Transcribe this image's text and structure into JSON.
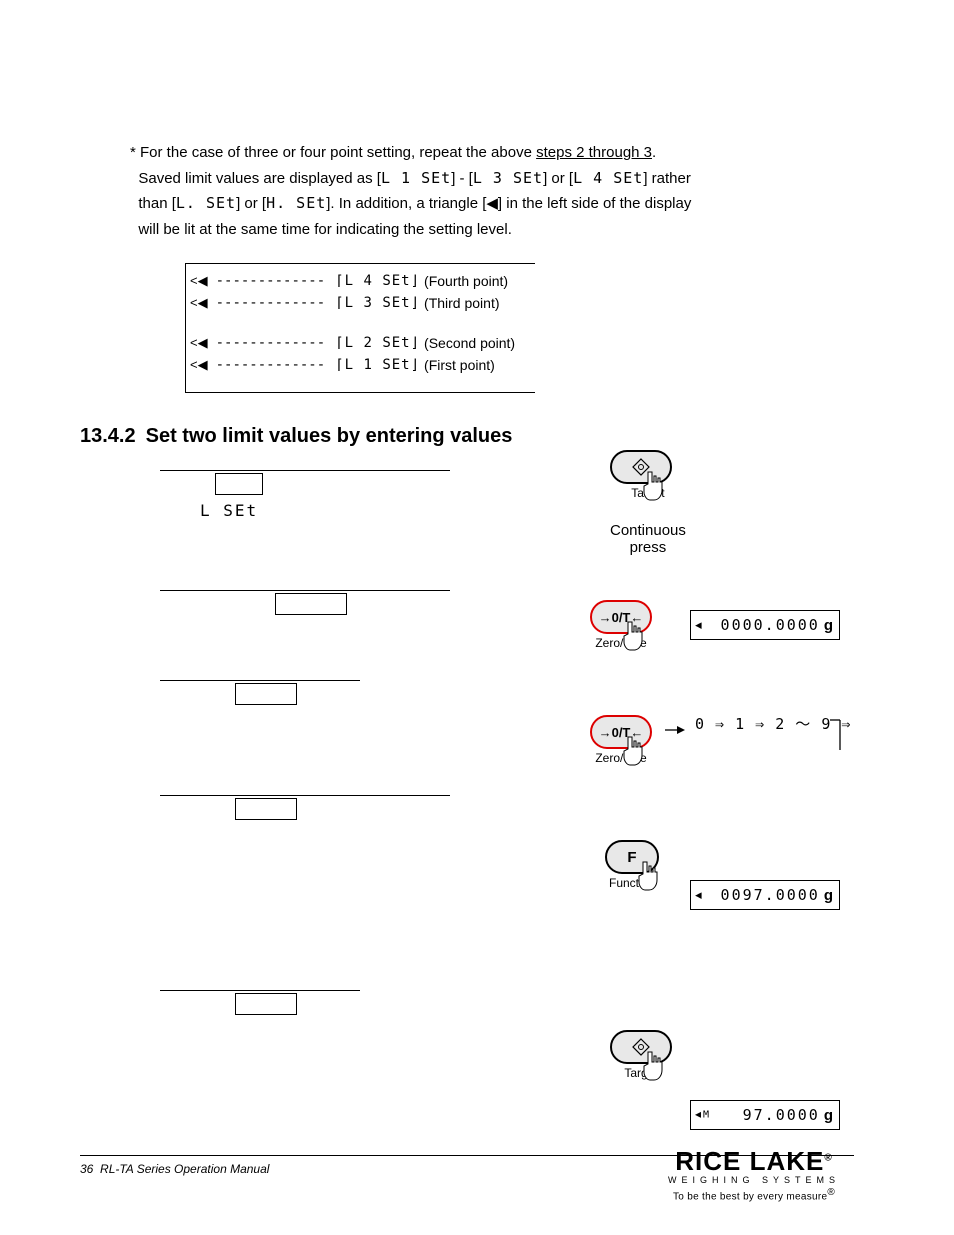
{
  "intro": {
    "asterisk": "*",
    "line1a": "For the case of three or four point setting, repeat the above ",
    "line1b": "steps 2 through 3",
    "line1c": ".",
    "line2a": "Saved limit values are displayed as [",
    "seg_l1": "L 1  SEt",
    "line2b": "] - [",
    "seg_l3": "L 3  SEt",
    "line2c": "] or [",
    "seg_l4": "L 4  SEt",
    "line2d": "] rather",
    "line3a": "than [",
    "seg_l": "L.  SEt",
    "line3b": "] or [",
    "seg_h": "H.  SEt",
    "line3c": "].   In addition, a triangle [◀] in the left side of the display",
    "line4": "will be lit at the same time for indicating the setting level."
  },
  "diagram": {
    "rows": [
      {
        "marker": "<◀",
        "dashes": "-------------",
        "seg": "⌈L 4  SEt⌋",
        "label": "(Fourth point)"
      },
      {
        "marker": "<◀",
        "dashes": "-------------",
        "seg": "⌈L 3  SEt⌋",
        "label": "(Third point)"
      },
      {
        "marker": "<◀",
        "dashes": "-------------",
        "seg": "⌈L 2  SEt⌋",
        "label": "(Second point)"
      },
      {
        "marker": "<◀",
        "dashes": "-------------",
        "seg": "⌈L 1  SEt⌋",
        "label": "(First point)"
      }
    ]
  },
  "heading": {
    "number": "13.4.2",
    "title": "Set two limit values by entering values"
  },
  "steps": {
    "lset": "L  SEt"
  },
  "illus": {
    "target_label": "Target",
    "continuous": "Continuous",
    "press": "press",
    "zero_key": "→0/T←",
    "zero_label": "Zero/Tare",
    "f_key": "F",
    "func_label": "Function",
    "lcd1": "0000.0000",
    "lcd1_unit": "g",
    "seq": "0 ⇒ 1 ⇒ 2 ～ 9 ⇒",
    "lcd3": "0097.0000",
    "lcd3_unit": "g",
    "lcd4": "97.0000",
    "lcd4_unit": "g"
  },
  "footer": {
    "page": "36",
    "title": "RL-TA Series Operation Manual",
    "logo_main": "RICE LAKE",
    "logo_sub": "WEIGHING SYSTEMS",
    "logo_tag": "To be the best by every measure",
    "reg": "®"
  }
}
